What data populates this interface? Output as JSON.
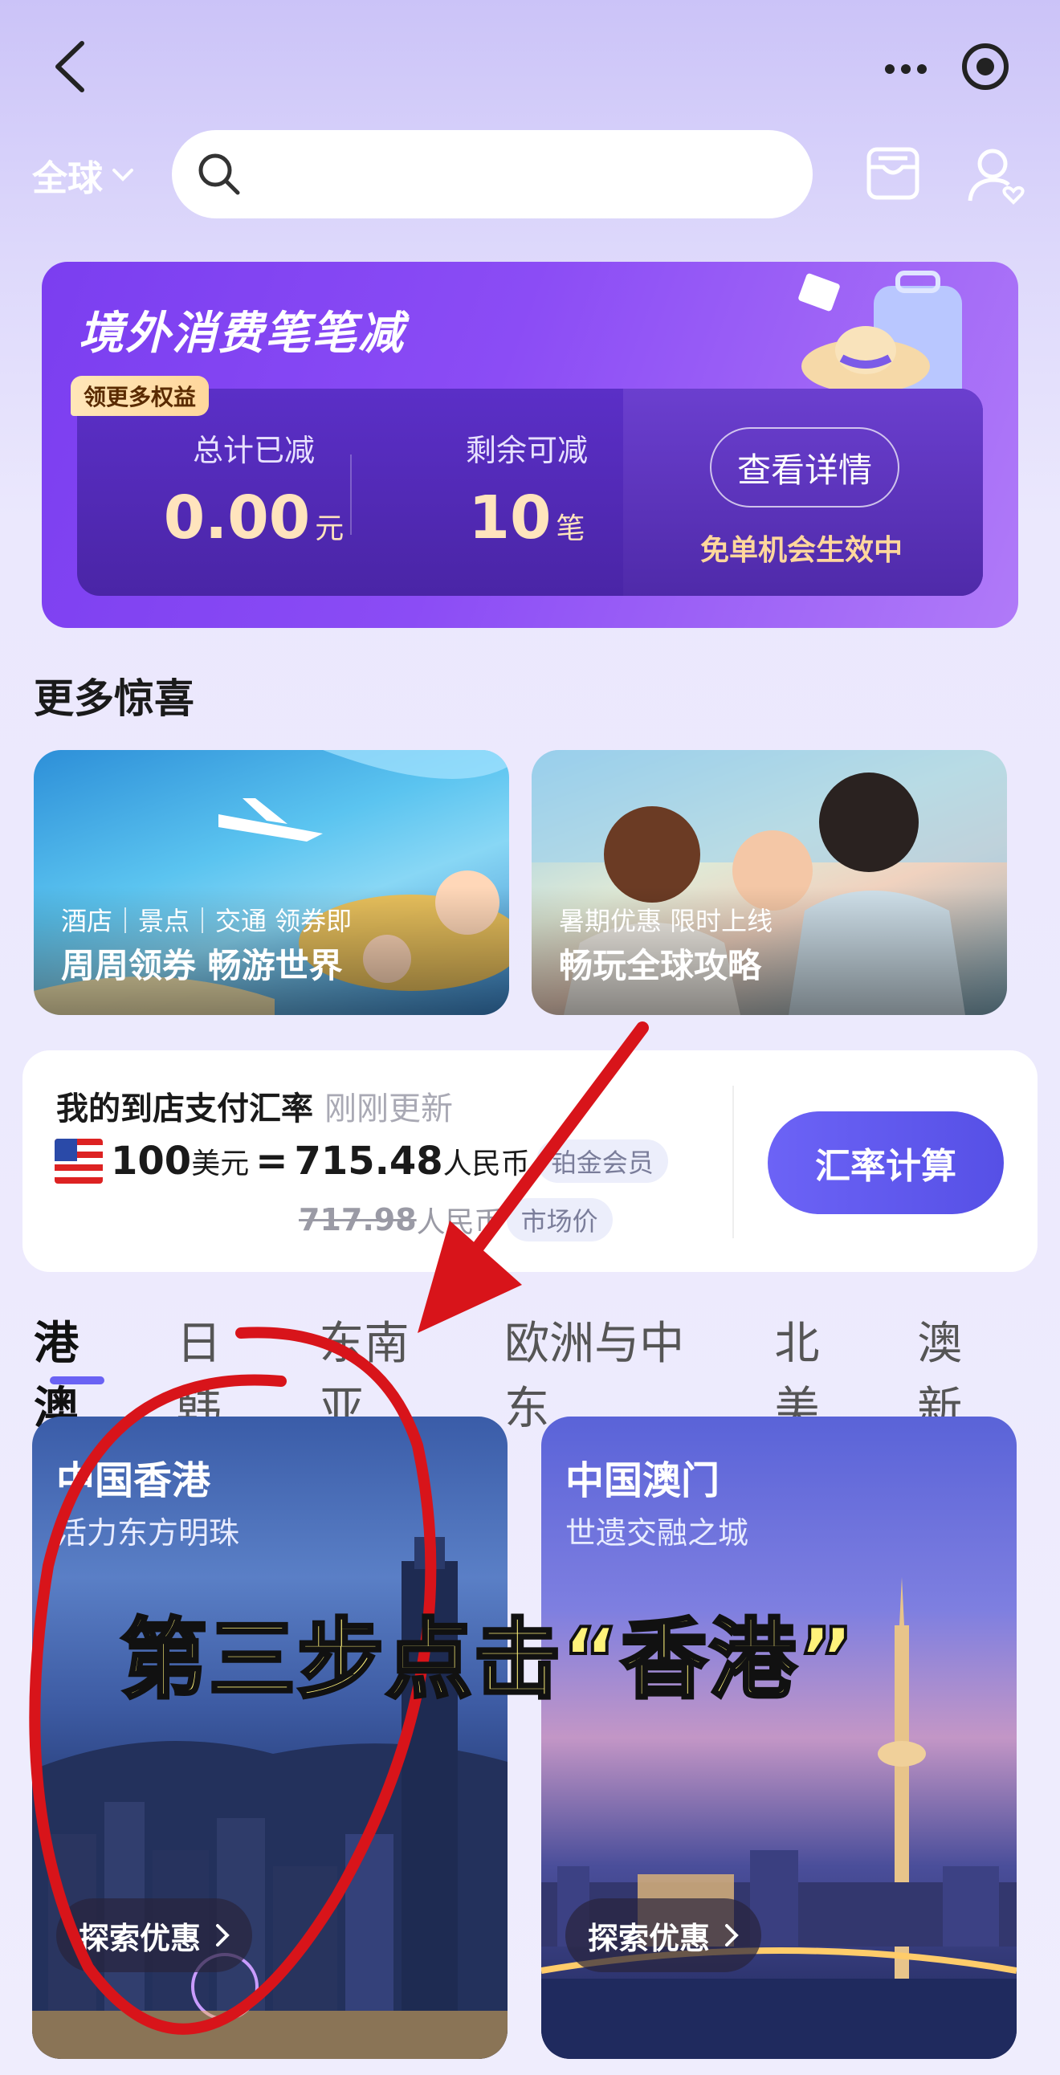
{
  "header": {
    "region_label": "全球",
    "search_placeholder": ""
  },
  "banner": {
    "title": "境外消费笔笔减",
    "tag": "领更多权益",
    "stat1_label": "总计已减",
    "stat1_value": "0.00",
    "stat1_unit": "元",
    "stat2_label": "剩余可减",
    "stat2_value": "10",
    "stat2_unit": "笔",
    "detail_button": "查看详情",
    "status_text": "免单机会生效中"
  },
  "surprises": {
    "title": "更多惊喜",
    "cards": [
      {
        "sub": "酒店｜景点｜交通 领券即",
        "main": "周周领券 畅游世界"
      },
      {
        "sub": "暑期优惠 限时上线",
        "main": "畅玩全球攻略"
      }
    ]
  },
  "exchange": {
    "title": "我的到店支付汇率",
    "updated": "刚刚更新",
    "amount": "100",
    "amount_unit": "美元",
    "equals": "=",
    "rate": "715.48",
    "rate_unit": "人民币",
    "member_badge": "铂金会员",
    "market_rate": "717.98",
    "market_unit": "人民币",
    "market_label": "市场价",
    "calc_button": "汇率计算"
  },
  "tabs": [
    "港澳",
    "日韩",
    "东南亚",
    "欧洲与中东",
    "北美",
    "澳新"
  ],
  "destinations": [
    {
      "name": "中国香港",
      "sub": "活力东方明珠",
      "button": "探索优惠"
    },
    {
      "name": "中国澳门",
      "sub": "世遗交融之城",
      "button": "探索优惠"
    }
  ],
  "overlay_caption": "第三步点击“香港”",
  "colors": {
    "accent": "#6a62f4",
    "banner": "#7b3ef0",
    "annotation_red": "#d8141a",
    "caption_yellow": "#fff27a"
  }
}
